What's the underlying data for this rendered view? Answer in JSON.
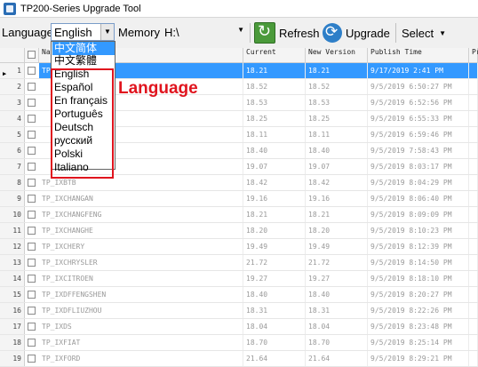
{
  "window": {
    "title": "TP200-Series Upgrade Tool"
  },
  "toolbar": {
    "language_label": "Language",
    "language_value": "English",
    "memory_label": "Memory",
    "memory_value": "H:\\",
    "refresh_label": "Refresh",
    "upgrade_label": "Upgrade",
    "select_label": "Select"
  },
  "columns": [
    "Na",
    "Current",
    "New Version",
    "Publish Time",
    "Pr"
  ],
  "rows": [
    {
      "num": "1",
      "name": "TP",
      "current": "18.21",
      "new": "18.21",
      "time": "9/17/2019 2:41 PM"
    },
    {
      "num": "2",
      "name": "",
      "current": "18.52",
      "new": "18.52",
      "time": "9/5/2019 6:50:27 PM"
    },
    {
      "num": "3",
      "name": "",
      "current": "18.53",
      "new": "18.53",
      "time": "9/5/2019 6:52:56 PM"
    },
    {
      "num": "4",
      "name": "",
      "current": "18.25",
      "new": "18.25",
      "time": "9/5/2019 6:55:33 PM"
    },
    {
      "num": "5",
      "name": "",
      "current": "18.11",
      "new": "18.11",
      "time": "9/5/2019 6:59:46 PM"
    },
    {
      "num": "6",
      "name": "",
      "current": "18.40",
      "new": "18.40",
      "time": "9/5/2019 7:58:43 PM"
    },
    {
      "num": "7",
      "name": "",
      "current": "19.07",
      "new": "19.07",
      "time": "9/5/2019 8:03:17 PM"
    },
    {
      "num": "8",
      "name": "TP_IXBTB",
      "current": "18.42",
      "new": "18.42",
      "time": "9/5/2019 8:04:29 PM"
    },
    {
      "num": "9",
      "name": "TP_IXCHANGAN",
      "current": "19.16",
      "new": "19.16",
      "time": "9/5/2019 8:06:40 PM"
    },
    {
      "num": "10",
      "name": "TP_IXCHANGFENG",
      "current": "18.21",
      "new": "18.21",
      "time": "9/5/2019 8:09:09 PM"
    },
    {
      "num": "11",
      "name": "TP_IXCHANGHE",
      "current": "18.20",
      "new": "18.20",
      "time": "9/5/2019 8:10:23 PM"
    },
    {
      "num": "12",
      "name": "TP_IXCHERY",
      "current": "19.49",
      "new": "19.49",
      "time": "9/5/2019 8:12:39 PM"
    },
    {
      "num": "13",
      "name": "TP_IXCHRYSLER",
      "current": "21.72",
      "new": "21.72",
      "time": "9/5/2019 8:14:50 PM"
    },
    {
      "num": "14",
      "name": "TP_IXCITROEN",
      "current": "19.27",
      "new": "19.27",
      "time": "9/5/2019 8:18:10 PM"
    },
    {
      "num": "15",
      "name": "TP_IXDFFENGSHEN",
      "current": "18.40",
      "new": "18.40",
      "time": "9/5/2019 8:20:27 PM"
    },
    {
      "num": "16",
      "name": "TP_IXDFLIUZHOU",
      "current": "18.31",
      "new": "18.31",
      "time": "9/5/2019 8:22:26 PM"
    },
    {
      "num": "17",
      "name": "TP_IXDS",
      "current": "18.04",
      "new": "18.04",
      "time": "9/5/2019 8:23:48 PM"
    },
    {
      "num": "18",
      "name": "TP_IXFIAT",
      "current": "18.70",
      "new": "18.70",
      "time": "9/5/2019 8:25:14 PM"
    },
    {
      "num": "19",
      "name": "TP_IXFORD",
      "current": "21.64",
      "new": "21.64",
      "time": "9/5/2019 8:29:21 PM"
    }
  ],
  "language_options": [
    "中文简体",
    "中文繁體",
    "English",
    "Español",
    "En français",
    "Português",
    "Deutsch",
    "русский",
    "Polski",
    "Italiano"
  ],
  "annotation": {
    "text": "Language",
    "color": "#e0141e"
  },
  "colors": {
    "selection": "#3399ff",
    "highlight_box": "#e0141e"
  }
}
